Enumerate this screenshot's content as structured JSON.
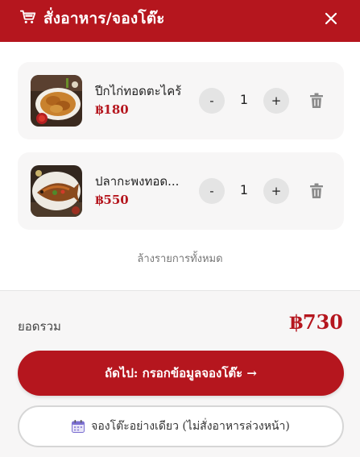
{
  "header": {
    "title": "สั่งอาหาร/จองโต๊ะ",
    "cart_icon": "shopping-cart-icon",
    "close_icon": "close-icon",
    "background": "#b5161e"
  },
  "cart": {
    "items": [
      {
        "name": "ปีกไก่ทอดตะไคร้",
        "price": "฿180",
        "quantity": "1",
        "minus": "-",
        "plus": "+",
        "thumbnail": "fried-chicken-wings-lemongrass-photo",
        "delete_icon": "trash-icon"
      },
      {
        "name": "ปลากะพงทอด...",
        "price": "฿550",
        "quantity": "1",
        "minus": "-",
        "plus": "+",
        "thumbnail": "fried-sea-bass-photo",
        "delete_icon": "trash-icon"
      }
    ],
    "clear_all": "ล้างรายการทั้งหมด"
  },
  "summary": {
    "total_label": "ยอดรวม",
    "total_value": "฿730"
  },
  "actions": {
    "primary_label": "ถัดไป: กรอกข้อมูลจองโต๊ะ →",
    "secondary_label": "จองโต๊ะอย่างเดียว (ไม่สั่งอาหารล่วงหน้า)",
    "secondary_icon": "calendar-icon"
  },
  "colors": {
    "accent": "#b5161e",
    "card": "#f7f6f6",
    "qty_button": "#e4e4e4"
  }
}
